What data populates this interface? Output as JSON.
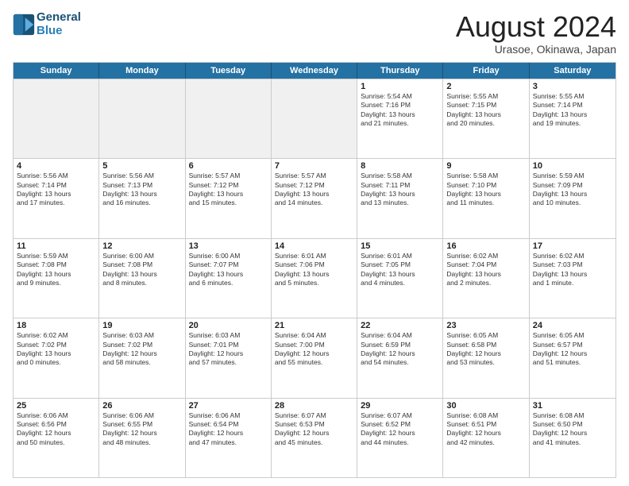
{
  "logo": {
    "line1": "General",
    "line2": "Blue"
  },
  "title": "August 2024",
  "location": "Urasoe, Okinawa, Japan",
  "header_days": [
    "Sunday",
    "Monday",
    "Tuesday",
    "Wednesday",
    "Thursday",
    "Friday",
    "Saturday"
  ],
  "rows": [
    [
      {
        "day": "",
        "info": "",
        "shaded": true
      },
      {
        "day": "",
        "info": "",
        "shaded": true
      },
      {
        "day": "",
        "info": "",
        "shaded": true
      },
      {
        "day": "",
        "info": "",
        "shaded": true
      },
      {
        "day": "1",
        "info": "Sunrise: 5:54 AM\nSunset: 7:16 PM\nDaylight: 13 hours\nand 21 minutes.",
        "shaded": false
      },
      {
        "day": "2",
        "info": "Sunrise: 5:55 AM\nSunset: 7:15 PM\nDaylight: 13 hours\nand 20 minutes.",
        "shaded": false
      },
      {
        "day": "3",
        "info": "Sunrise: 5:55 AM\nSunset: 7:14 PM\nDaylight: 13 hours\nand 19 minutes.",
        "shaded": false
      }
    ],
    [
      {
        "day": "4",
        "info": "Sunrise: 5:56 AM\nSunset: 7:14 PM\nDaylight: 13 hours\nand 17 minutes.",
        "shaded": false
      },
      {
        "day": "5",
        "info": "Sunrise: 5:56 AM\nSunset: 7:13 PM\nDaylight: 13 hours\nand 16 minutes.",
        "shaded": false
      },
      {
        "day": "6",
        "info": "Sunrise: 5:57 AM\nSunset: 7:12 PM\nDaylight: 13 hours\nand 15 minutes.",
        "shaded": false
      },
      {
        "day": "7",
        "info": "Sunrise: 5:57 AM\nSunset: 7:12 PM\nDaylight: 13 hours\nand 14 minutes.",
        "shaded": false
      },
      {
        "day": "8",
        "info": "Sunrise: 5:58 AM\nSunset: 7:11 PM\nDaylight: 13 hours\nand 13 minutes.",
        "shaded": false
      },
      {
        "day": "9",
        "info": "Sunrise: 5:58 AM\nSunset: 7:10 PM\nDaylight: 13 hours\nand 11 minutes.",
        "shaded": false
      },
      {
        "day": "10",
        "info": "Sunrise: 5:59 AM\nSunset: 7:09 PM\nDaylight: 13 hours\nand 10 minutes.",
        "shaded": false
      }
    ],
    [
      {
        "day": "11",
        "info": "Sunrise: 5:59 AM\nSunset: 7:08 PM\nDaylight: 13 hours\nand 9 minutes.",
        "shaded": false
      },
      {
        "day": "12",
        "info": "Sunrise: 6:00 AM\nSunset: 7:08 PM\nDaylight: 13 hours\nand 8 minutes.",
        "shaded": false
      },
      {
        "day": "13",
        "info": "Sunrise: 6:00 AM\nSunset: 7:07 PM\nDaylight: 13 hours\nand 6 minutes.",
        "shaded": false
      },
      {
        "day": "14",
        "info": "Sunrise: 6:01 AM\nSunset: 7:06 PM\nDaylight: 13 hours\nand 5 minutes.",
        "shaded": false
      },
      {
        "day": "15",
        "info": "Sunrise: 6:01 AM\nSunset: 7:05 PM\nDaylight: 13 hours\nand 4 minutes.",
        "shaded": false
      },
      {
        "day": "16",
        "info": "Sunrise: 6:02 AM\nSunset: 7:04 PM\nDaylight: 13 hours\nand 2 minutes.",
        "shaded": false
      },
      {
        "day": "17",
        "info": "Sunrise: 6:02 AM\nSunset: 7:03 PM\nDaylight: 13 hours\nand 1 minute.",
        "shaded": false
      }
    ],
    [
      {
        "day": "18",
        "info": "Sunrise: 6:02 AM\nSunset: 7:02 PM\nDaylight: 13 hours\nand 0 minutes.",
        "shaded": false
      },
      {
        "day": "19",
        "info": "Sunrise: 6:03 AM\nSunset: 7:02 PM\nDaylight: 12 hours\nand 58 minutes.",
        "shaded": false
      },
      {
        "day": "20",
        "info": "Sunrise: 6:03 AM\nSunset: 7:01 PM\nDaylight: 12 hours\nand 57 minutes.",
        "shaded": false
      },
      {
        "day": "21",
        "info": "Sunrise: 6:04 AM\nSunset: 7:00 PM\nDaylight: 12 hours\nand 55 minutes.",
        "shaded": false
      },
      {
        "day": "22",
        "info": "Sunrise: 6:04 AM\nSunset: 6:59 PM\nDaylight: 12 hours\nand 54 minutes.",
        "shaded": false
      },
      {
        "day": "23",
        "info": "Sunrise: 6:05 AM\nSunset: 6:58 PM\nDaylight: 12 hours\nand 53 minutes.",
        "shaded": false
      },
      {
        "day": "24",
        "info": "Sunrise: 6:05 AM\nSunset: 6:57 PM\nDaylight: 12 hours\nand 51 minutes.",
        "shaded": false
      }
    ],
    [
      {
        "day": "25",
        "info": "Sunrise: 6:06 AM\nSunset: 6:56 PM\nDaylight: 12 hours\nand 50 minutes.",
        "shaded": false
      },
      {
        "day": "26",
        "info": "Sunrise: 6:06 AM\nSunset: 6:55 PM\nDaylight: 12 hours\nand 48 minutes.",
        "shaded": false
      },
      {
        "day": "27",
        "info": "Sunrise: 6:06 AM\nSunset: 6:54 PM\nDaylight: 12 hours\nand 47 minutes.",
        "shaded": false
      },
      {
        "day": "28",
        "info": "Sunrise: 6:07 AM\nSunset: 6:53 PM\nDaylight: 12 hours\nand 45 minutes.",
        "shaded": false
      },
      {
        "day": "29",
        "info": "Sunrise: 6:07 AM\nSunset: 6:52 PM\nDaylight: 12 hours\nand 44 minutes.",
        "shaded": false
      },
      {
        "day": "30",
        "info": "Sunrise: 6:08 AM\nSunset: 6:51 PM\nDaylight: 12 hours\nand 42 minutes.",
        "shaded": false
      },
      {
        "day": "31",
        "info": "Sunrise: 6:08 AM\nSunset: 6:50 PM\nDaylight: 12 hours\nand 41 minutes.",
        "shaded": false
      }
    ]
  ]
}
